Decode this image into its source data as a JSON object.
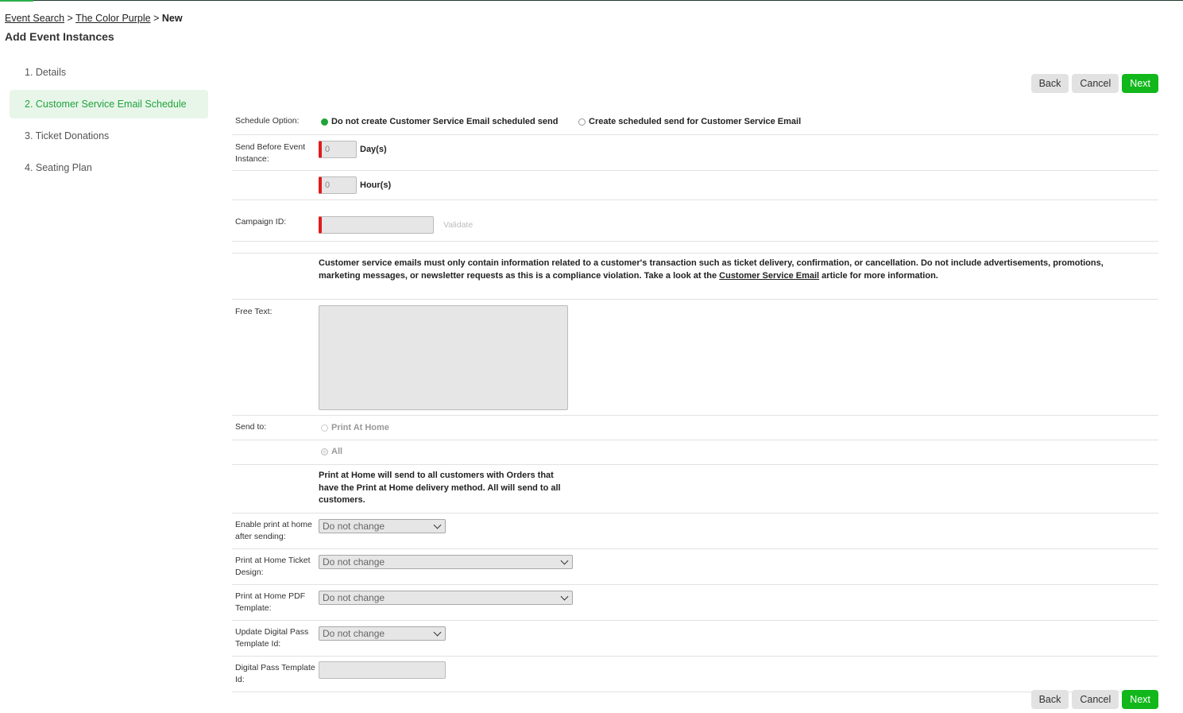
{
  "breadcrumb": {
    "items": [
      "Event Search",
      "The Color Purple"
    ],
    "current": "New",
    "separator": ">"
  },
  "page": {
    "title": "Add Event Instances"
  },
  "steps": [
    {
      "label": "1. Details",
      "active": false
    },
    {
      "label": "2. Customer Service Email Schedule",
      "active": true
    },
    {
      "label": "3. Ticket Donations",
      "active": false
    },
    {
      "label": "4. Seating Plan",
      "active": false
    }
  ],
  "buttons": {
    "back": "Back",
    "cancel": "Cancel",
    "next": "Next"
  },
  "form": {
    "schedule_option": {
      "label": "Schedule Option:",
      "options": [
        "Do not create Customer Service Email scheduled send",
        "Create scheduled send for Customer Service Email"
      ],
      "selected": "Do not create Customer Service Email scheduled send"
    },
    "send_before": {
      "label": "Send Before Event Instance:",
      "days_value": "0",
      "days_unit": "Day(s)",
      "hours_value": "0",
      "hours_unit": "Hour(s)"
    },
    "campaign": {
      "label": "Campaign ID:",
      "value": "",
      "validate": "Validate"
    },
    "notice": {
      "text_before": "Customer service emails must only contain information related to a customer's transaction such as ticket delivery, confirmation, or cancellation. Do not include advertisements, promotions, marketing messages, or newsletter requests as this is a compliance violation. Take a look at the ",
      "link": "Customer Service Email",
      "text_after": " article for more information."
    },
    "free_text": {
      "label": "Free Text:",
      "value": ""
    },
    "send_to": {
      "label": "Send to:",
      "options": [
        "Print At Home",
        "All"
      ],
      "selected": "All",
      "help": "Print at Home will send to all customers with Orders that have the Print at Home delivery method. All will send to all customers."
    },
    "enable_pah": {
      "label": "Enable print at home after sending:",
      "value": "Do not change"
    },
    "pah_ticket_design": {
      "label": "Print at Home Ticket Design:",
      "value": "Do not change"
    },
    "pah_pdf_template": {
      "label": "Print at Home PDF Template:",
      "value": "Do not change"
    },
    "update_digital_pass": {
      "label": "Update Digital Pass Template Id:",
      "value": "Do not change"
    },
    "digital_pass_template": {
      "label": "Digital Pass Template Id:",
      "value": ""
    }
  },
  "colors": {
    "accent": "#12b71c",
    "required": "#e01b1b",
    "active_step_bg": "#e8f6ea"
  },
  "icons": {
    "select_arrow": "chevron-down-icon"
  }
}
